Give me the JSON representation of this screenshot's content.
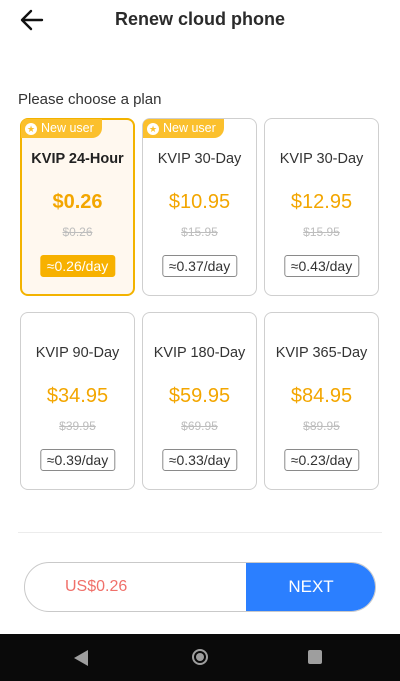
{
  "header": {
    "title": "Renew cloud phone",
    "back_icon": "arrow-left-icon"
  },
  "section_label": "Please choose a plan",
  "plans": [
    {
      "name": "KVIP 24-Hour",
      "price": "$0.26",
      "original": "$0.26",
      "per_day": "≈0.26/day",
      "badge": "New user",
      "selected": true
    },
    {
      "name": "KVIP 30-Day",
      "price": "$10.95",
      "original": "$15.95",
      "per_day": "≈0.37/day",
      "badge": "New user",
      "selected": false
    },
    {
      "name": "KVIP 30-Day",
      "price": "$12.95",
      "original": "$15.95",
      "per_day": "≈0.43/day",
      "badge": "",
      "selected": false
    },
    {
      "name": "KVIP 90-Day",
      "price": "$34.95",
      "original": "$39.95",
      "per_day": "≈0.39/day",
      "badge": "",
      "selected": false
    },
    {
      "name": "KVIP 180-Day",
      "price": "$59.95",
      "original": "$69.95",
      "per_day": "≈0.33/day",
      "badge": "",
      "selected": false
    },
    {
      "name": "KVIP 365-Day",
      "price": "$84.95",
      "original": "$89.95",
      "per_day": "≈0.23/day",
      "badge": "",
      "selected": false
    }
  ],
  "footer": {
    "total": "US$0.26",
    "next_label": "NEXT"
  },
  "colors": {
    "accent": "#f3a600",
    "badge": "#fbc02d",
    "primary_button": "#2b7fff",
    "total_text": "#f0706a"
  }
}
